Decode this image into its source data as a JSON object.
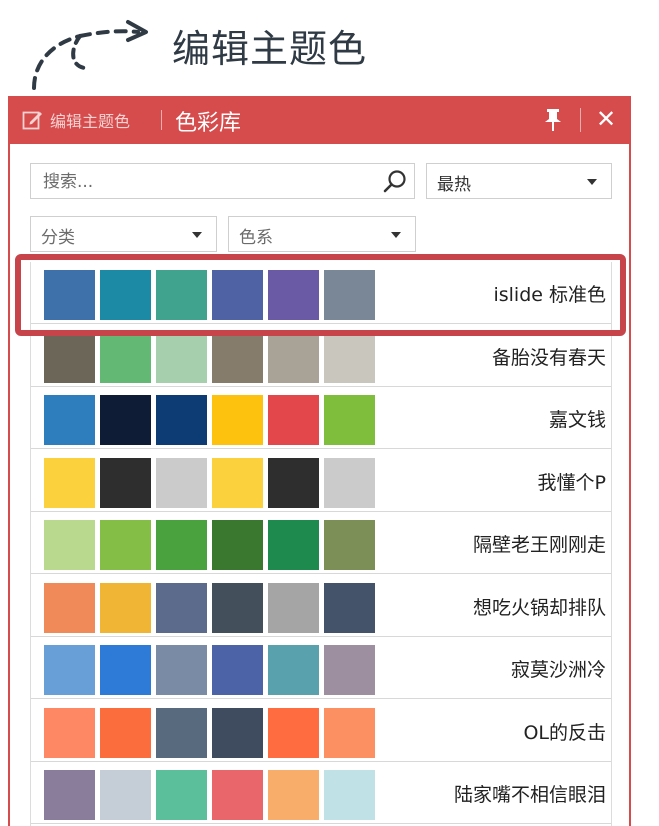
{
  "annotation": {
    "text": "编辑主题色"
  },
  "titlebar": {
    "edit_label": "编辑主题色",
    "title": "色彩库",
    "icons": [
      "edit-icon",
      "pin-icon",
      "close-icon"
    ],
    "color": "#d64b4b"
  },
  "search": {
    "placeholder": "搜索...",
    "value": ""
  },
  "filters": {
    "sort": {
      "value": "最热"
    },
    "category": {
      "value": "分类"
    },
    "tone": {
      "value": "色系"
    }
  },
  "palettes": [
    {
      "name": "islide 标准色",
      "colors": [
        "#3e70aa",
        "#1c8aa4",
        "#3fa38e",
        "#4e62a4",
        "#6a5aa6",
        "#7a8796"
      ]
    },
    {
      "name": "备胎没有春天",
      "colors": [
        "#6b6658",
        "#63b873",
        "#a5cfad",
        "#857c6c",
        "#a8a396",
        "#c8c6bd"
      ]
    },
    {
      "name": "嘉文钱",
      "colors": [
        "#2e7dbd",
        "#0e1c36",
        "#0d3c74",
        "#fcc20e",
        "#e4474b",
        "#7fbd3c"
      ]
    },
    {
      "name": "我懂个P",
      "colors": [
        "#fbd13e",
        "#2e2e2e",
        "#cbcbcb",
        "#fbd13e",
        "#2e2e2e",
        "#cbcbcb"
      ]
    },
    {
      "name": "隔壁老王刚刚走",
      "colors": [
        "#b8d98e",
        "#84be47",
        "#4aa23e",
        "#3a7830",
        "#1f8a4e",
        "#7b8f56"
      ]
    },
    {
      "name": "想吃火锅却排队",
      "colors": [
        "#f08a58",
        "#f0b534",
        "#5c6a8c",
        "#434f5b",
        "#a5a5a5",
        "#44526a"
      ]
    },
    {
      "name": "寂莫沙洲冷",
      "colors": [
        "#689fd6",
        "#2d7bd7",
        "#7a8ba6",
        "#4c63a8",
        "#59a2ad",
        "#9e8fa0"
      ]
    },
    {
      "name": "OL的反击",
      "colors": [
        "#fd8863",
        "#fc6d3e",
        "#586a7d",
        "#3f4c5f",
        "#fe6c40",
        "#fc9063"
      ]
    },
    {
      "name": "陆家嘴不相信眼泪",
      "colors": [
        "#8a7d9b",
        "#c5cdd6",
        "#5bbf9c",
        "#e9666a",
        "#f9ad6a",
        "#c0e1e6"
      ]
    }
  ]
}
